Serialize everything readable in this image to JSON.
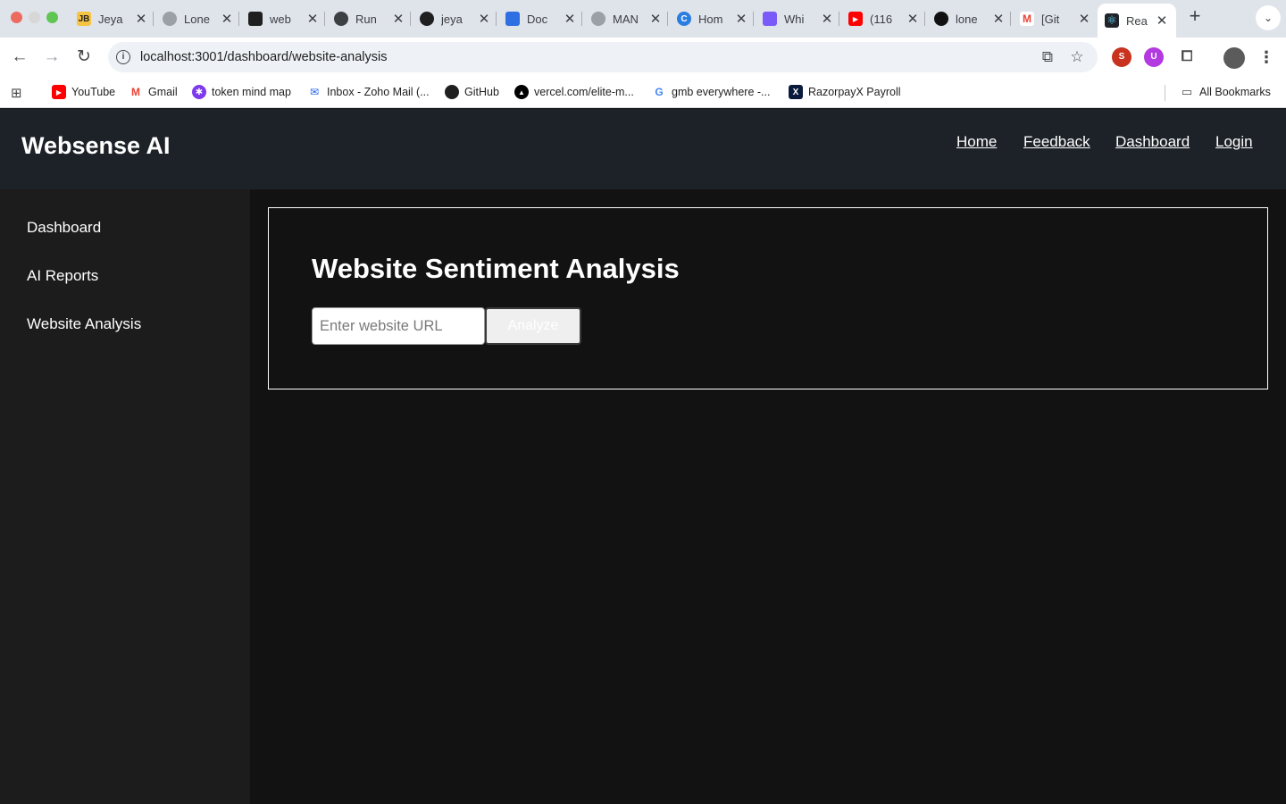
{
  "browser": {
    "tabs": [
      {
        "title": "Jeya",
        "favicon_text": "JB",
        "favicon_color": "#f6c343"
      },
      {
        "title": "Lone",
        "favicon_text": "",
        "favicon_color": "#9aa0a6"
      },
      {
        "title": "web",
        "favicon_text": "",
        "favicon_color": "#1f1f1f"
      },
      {
        "title": "Run",
        "favicon_text": "",
        "favicon_color": "#3c4043"
      },
      {
        "title": "jeya",
        "favicon_text": "",
        "favicon_color": "#1f1f1f"
      },
      {
        "title": "Doc",
        "favicon_text": "",
        "favicon_color": "#2f6fe4"
      },
      {
        "title": "MAN",
        "favicon_text": "",
        "favicon_color": "#9aa0a6"
      },
      {
        "title": "Hom",
        "favicon_text": "C",
        "favicon_color": "#2a7de1"
      },
      {
        "title": "Whi",
        "favicon_text": "",
        "favicon_color": "#7a5af8"
      },
      {
        "title": "(116",
        "favicon_text": "▶",
        "favicon_color": "#ff0000"
      },
      {
        "title": "lone",
        "favicon_text": "",
        "favicon_color": "#111111"
      },
      {
        "title": "[Git",
        "favicon_text": "M",
        "favicon_color": "#ea4335"
      },
      {
        "title": "Rea",
        "favicon_text": "⚛",
        "favicon_color": "#20232a"
      }
    ],
    "new_tab_label": "+",
    "tab_search_label": "⌄",
    "url": "localhost:3001/dashboard/website-analysis",
    "bookmarks": [
      {
        "label": "YouTube",
        "icon": "youtube-icon",
        "color": "#ff0000",
        "glyph": "▶"
      },
      {
        "label": "Gmail",
        "icon": "gmail-icon",
        "color": "#ea4335",
        "glyph": "M"
      },
      {
        "label": "token mind map",
        "icon": "mindmap-icon",
        "color": "#7c3aed",
        "glyph": "✱"
      },
      {
        "label": "Inbox - Zoho Mail (...",
        "icon": "zoho-mail-icon",
        "color": "#2563eb",
        "glyph": "✉"
      },
      {
        "label": "GitHub",
        "icon": "github-icon",
        "color": "#1f1f1f",
        "glyph": "●"
      },
      {
        "label": "vercel.com/elite-m...",
        "icon": "vercel-icon",
        "color": "#000000",
        "glyph": "▲"
      },
      {
        "label": "gmb everywhere -...",
        "icon": "google-icon",
        "color": "#4285f4",
        "glyph": "G"
      },
      {
        "label": "RazorpayX Payroll",
        "icon": "razorpay-icon",
        "color": "#0b1b3b",
        "glyph": "X"
      }
    ],
    "all_bookmarks_label": "All Bookmarks"
  },
  "app": {
    "brand": "Websense AI",
    "nav": [
      "Home",
      "Feedback",
      "Dashboard",
      "Login"
    ],
    "sidebar": [
      "Dashboard",
      "AI Reports",
      "Website Analysis"
    ],
    "page_title": "Website Sentiment Analysis",
    "url_placeholder": "Enter website URL",
    "analyze_label": "Analyze"
  },
  "colors": {
    "header_bg": "#1d2228",
    "sidebar_bg": "#1c1c1c",
    "main_bg": "#121212"
  }
}
